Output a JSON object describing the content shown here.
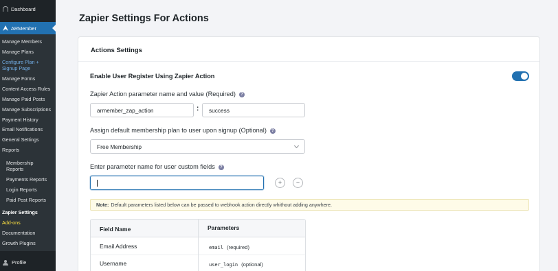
{
  "sidebar": {
    "dashboard": "Dashboard",
    "active_menu": "ARMember",
    "items": [
      {
        "label": "Manage Members"
      },
      {
        "label": "Manage Plans"
      },
      {
        "label": "Configure Plan +"
      },
      {
        "label": "Signup Page"
      },
      {
        "label": "Manage Forms"
      },
      {
        "label": "Content Access Rules"
      },
      {
        "label": "Manage Paid Posts"
      },
      {
        "label": "Manage Subscriptions"
      },
      {
        "label": "Payment History"
      },
      {
        "label": "Email Notifications"
      },
      {
        "label": "General Settings"
      },
      {
        "label": "Reports"
      },
      {
        "label": "Membership"
      },
      {
        "label": "Reports"
      },
      {
        "label": "Payments Reports"
      },
      {
        "label": "Login Reports"
      },
      {
        "label": "Paid Post Reports"
      },
      {
        "label": "Zapier Settings"
      },
      {
        "label": "Add-ons"
      },
      {
        "label": "Documentation"
      },
      {
        "label": "Growth Plugins"
      }
    ],
    "profile": "Profile"
  },
  "page": {
    "title": "Zapier Settings For Actions"
  },
  "card": {
    "title": "Actions Settings",
    "enable_label": "Enable User Register Using Zapier Action",
    "enable_on": true,
    "param_label": "Zapier Action parameter name and value (Required)",
    "param_name": "armember_zap_action",
    "param_value": "success",
    "plan_label": "Assign default membership plan to user upon signup (Optional)",
    "plan_selected": "Free Membership",
    "custom_label": "Enter parameter name for user custom fields",
    "custom_value": "",
    "add_symbol": "+",
    "remove_symbol": "−",
    "help_symbol": "?",
    "note_prefix": "Note:",
    "note_text": "Default parameters listed below can be passed to webhook action directly whithout adding anywhere.",
    "table": {
      "headers": [
        "Field Name",
        "Parameters"
      ],
      "rows": [
        {
          "field": "Email Address",
          "param": "email",
          "req": "(required)"
        },
        {
          "field": "Username",
          "param": "user_login",
          "req": "(optional)"
        }
      ]
    }
  },
  "colors": {
    "accent": "#2271b1",
    "sidebar": "#1e2327",
    "submenu": "#2c3338",
    "highlight_cyan": "#72aee6",
    "highlight_yellow": "#ffe341"
  }
}
